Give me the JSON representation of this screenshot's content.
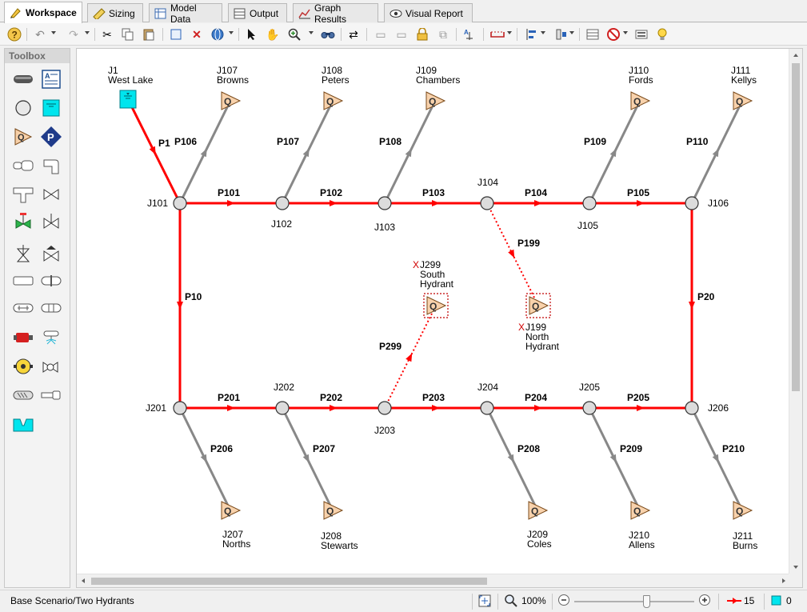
{
  "tabs": [
    {
      "label": "Workspace",
      "icon": "workspace-icon",
      "active": true
    },
    {
      "label": "Sizing",
      "icon": "sizing-icon"
    },
    {
      "label": "Model Data",
      "icon": "model-data-icon"
    },
    {
      "label": "Output",
      "icon": "output-icon"
    },
    {
      "label": "Graph Results",
      "icon": "graph-results-icon"
    },
    {
      "label": "Visual Report",
      "icon": "visual-report-icon"
    }
  ],
  "toolbox": {
    "title": "Toolbox"
  },
  "model": {
    "pipe_color": "#ff0000",
    "branch_color": "#888888",
    "junctions": [
      {
        "id": "J101",
        "label": "J101"
      },
      {
        "id": "J102",
        "label": "J102"
      },
      {
        "id": "J103",
        "label": "J103"
      },
      {
        "id": "J104",
        "label": "J104"
      },
      {
        "id": "J105",
        "label": "J105"
      },
      {
        "id": "J106",
        "label": "J106"
      },
      {
        "id": "J201",
        "label": "J201"
      },
      {
        "id": "J202",
        "label": "J202"
      },
      {
        "id": "J203",
        "label": "J203"
      },
      {
        "id": "J204",
        "label": "J204"
      },
      {
        "id": "J205",
        "label": "J205"
      },
      {
        "id": "J206",
        "label": "J206"
      }
    ],
    "reservoir": {
      "id": "J1",
      "name": "West Lake"
    },
    "demands": [
      {
        "id": "J107",
        "name": "Browns"
      },
      {
        "id": "J108",
        "name": "Peters"
      },
      {
        "id": "J109",
        "name": "Chambers"
      },
      {
        "id": "J110",
        "name": "Fords"
      },
      {
        "id": "J111",
        "name": "Kellys"
      },
      {
        "id": "J207",
        "name": "Norths"
      },
      {
        "id": "J208",
        "name": "Stewarts"
      },
      {
        "id": "J209",
        "name": "Coles"
      },
      {
        "id": "J210",
        "name": "Allens"
      },
      {
        "id": "J211",
        "name": "Burns"
      }
    ],
    "hydrants": [
      {
        "id": "J299",
        "name1": "South",
        "name2": "Hydrant",
        "closed_mark": "X"
      },
      {
        "id": "J199",
        "name1": "North",
        "name2": "Hydrant",
        "closed_mark": "X"
      }
    ],
    "pipes": [
      "P1",
      "P10",
      "P20",
      "P101",
      "P102",
      "P103",
      "P104",
      "P105",
      "P106",
      "P107",
      "P108",
      "P109",
      "P110",
      "P199",
      "P201",
      "P202",
      "P203",
      "P204",
      "P205",
      "P206",
      "P207",
      "P208",
      "P209",
      "P210",
      "P299"
    ]
  },
  "status": {
    "scenario": "Base Scenario/Two Hydrants",
    "zoom": "100%",
    "zoom_level_fraction": 0.6,
    "pipe_count": "15",
    "junction_count": "0"
  }
}
